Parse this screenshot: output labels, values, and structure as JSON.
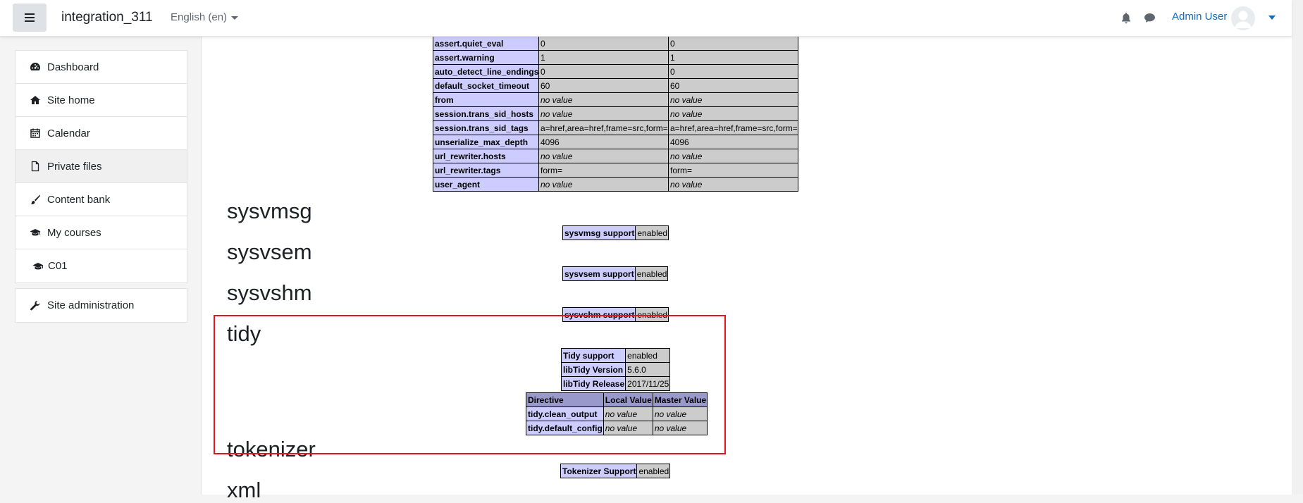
{
  "navbar": {
    "site_name": "integration_311",
    "language": "English (en)",
    "user_name": "Admin User"
  },
  "nav": {
    "items": [
      {
        "label": "Dashboard",
        "icon": "dashboard-icon"
      },
      {
        "label": "Site home",
        "icon": "home-icon"
      },
      {
        "label": "Calendar",
        "icon": "calendar-icon"
      },
      {
        "label": "Private files",
        "icon": "file-icon"
      },
      {
        "label": "Content bank",
        "icon": "paint-brush-icon"
      },
      {
        "label": "My courses",
        "icon": "graduation-cap-icon"
      },
      {
        "label": "C01",
        "icon": "graduation-cap-icon"
      }
    ],
    "admin_item": {
      "label": "Site administration",
      "icon": "wrench-icon"
    }
  },
  "standard_table": {
    "rows": [
      [
        "assert.quiet_eval",
        "0",
        "0"
      ],
      [
        "assert.warning",
        "1",
        "1"
      ],
      [
        "auto_detect_line_endings",
        "0",
        "0"
      ],
      [
        "default_socket_timeout",
        "60",
        "60"
      ],
      [
        "from",
        "no value",
        "no value"
      ],
      [
        "session.trans_sid_hosts",
        "no value",
        "no value"
      ],
      [
        "session.trans_sid_tags",
        "a=href,area=href,frame=src,form=",
        "a=href,area=href,frame=src,form="
      ],
      [
        "unserialize_max_depth",
        "4096",
        "4096"
      ],
      [
        "url_rewriter.hosts",
        "no value",
        "no value"
      ],
      [
        "url_rewriter.tags",
        "form=",
        "form="
      ],
      [
        "user_agent",
        "no value",
        "no value"
      ]
    ]
  },
  "sections": {
    "sysvmsg": {
      "title": "sysvmsg",
      "key": "sysvmsg support",
      "value": "enabled"
    },
    "sysvsem": {
      "title": "sysvsem",
      "key": "sysvsem support",
      "value": "enabled"
    },
    "sysvshm": {
      "title": "sysvshm",
      "key": "sysvshm support",
      "value": "enabled"
    },
    "tidy": {
      "title": "tidy",
      "info": [
        [
          "Tidy support",
          "enabled"
        ],
        [
          "libTidy Version",
          "5.6.0"
        ],
        [
          "libTidy Release",
          "2017/11/25"
        ]
      ],
      "headers": [
        "Directive",
        "Local Value",
        "Master Value"
      ],
      "directives": [
        [
          "tidy.clean_output",
          "no value",
          "no value"
        ],
        [
          "tidy.default_config",
          "no value",
          "no value"
        ]
      ]
    },
    "tokenizer": {
      "title": "tokenizer",
      "key": "Tokenizer Support",
      "value": "enabled"
    },
    "xml": {
      "title": "xml"
    }
  },
  "colors": {
    "link": "#0f6cbf",
    "highlight_border": "#e8141d",
    "php_key_bg": "#ccccff",
    "php_value_bg": "#cccccc",
    "php_header_bg": "#9999cc"
  }
}
